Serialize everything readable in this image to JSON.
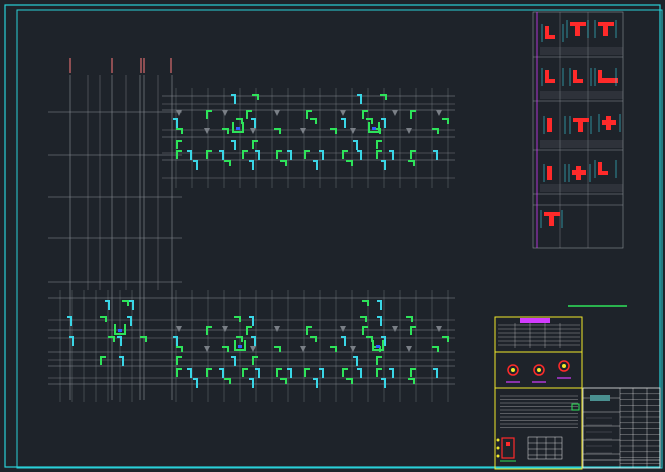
{
  "app": {
    "view": "cad-drawing-canvas"
  },
  "colors": {
    "background": "#1e232a",
    "frame": "#29d0d8",
    "grid": "#8a8f96",
    "column": "#7a7f86",
    "wall_green": "#2ee35a",
    "annotation_cyan": "#3ad6e6",
    "detail_red": "#ff2a2a",
    "detail_magenta": "#d23cff",
    "note_yellow": "#f2ea2a",
    "title_block_white": "#e8e8e8",
    "dim_pink": "#ff7a7a"
  },
  "layers": [
    {
      "name": "axis-grid",
      "icon": "grid-lines-icon"
    },
    {
      "name": "walls",
      "icon": "wall-segment-icon"
    },
    {
      "name": "annotations",
      "icon": "dimension-mark-icon"
    },
    {
      "name": "details",
      "icon": "section-detail-icon"
    },
    {
      "name": "notes",
      "icon": "table-icon"
    },
    {
      "name": "title-block",
      "icon": "title-block-icon"
    }
  ]
}
